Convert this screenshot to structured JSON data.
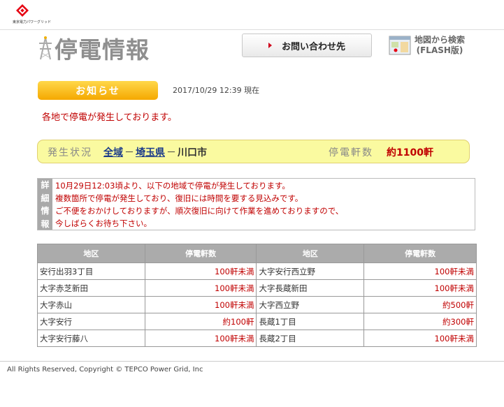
{
  "header": {
    "company": "東京電力パワーグリッド",
    "title": "停電情報",
    "contact_button": "お問い合わせ先",
    "map_search_line1": "地図から検索",
    "map_search_line2": "(FLASH版)"
  },
  "notice": {
    "label": "お知らせ",
    "timestamp": "2017/10/29 12:39 現在",
    "message": "各地で停電が発生しております。"
  },
  "status": {
    "label": "発生状況",
    "area_all": "全域",
    "area_pref": "埼玉県",
    "area_city": "川口市",
    "sep1": "－",
    "sep2": "－",
    "count_label": "停電軒数",
    "count_value": "約1100軒"
  },
  "details": {
    "side": [
      "詳",
      "細",
      "情",
      "報"
    ],
    "lines": [
      "10月29日12:03頃より、以下の地域で停電が発生しております。",
      "複数箇所で停電が発生しており、復旧には時間を要する見込みです。",
      "ご不便をおかけしておりますが、順次復旧に向けて作業を進めておりますので、",
      "今しばらくお待ち下さい。"
    ]
  },
  "table": {
    "headers": [
      "地区",
      "停電軒数",
      "地区",
      "停電軒数"
    ],
    "rows": [
      [
        "安行出羽3丁目",
        "100軒未満",
        "大字安行西立野",
        "100軒未満"
      ],
      [
        "大字赤芝新田",
        "100軒未満",
        "大字長蔵新田",
        "100軒未満"
      ],
      [
        "大字赤山",
        "100軒未満",
        "大字西立野",
        "約500軒"
      ],
      [
        "大字安行",
        "約100軒",
        "長蔵1丁目",
        "約300軒"
      ],
      [
        "大字安行藤八",
        "100軒未満",
        "長蔵2丁目",
        "100軒未満"
      ]
    ]
  },
  "footer": "All Rights Reserved, Copyright © TEPCO Power Grid, Inc",
  "colors": {
    "accent_red": "#c00000",
    "notice_orange": "#f5a800",
    "status_yellow": "#fafaa0",
    "table_header_gray": "#ababab"
  },
  "icons": [
    "company-logo-icon",
    "power-tower-icon",
    "triangle-right-icon",
    "map-icon"
  ]
}
